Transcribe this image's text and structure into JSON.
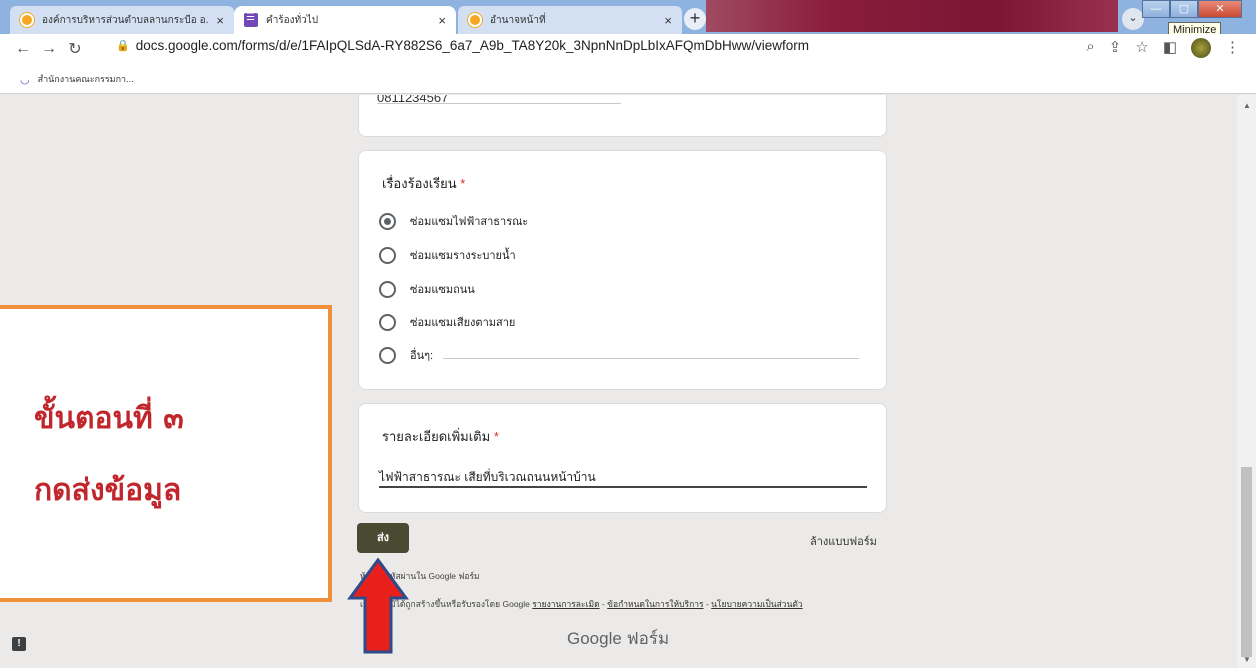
{
  "browser": {
    "tabs": [
      {
        "label": "องค์การบริหารส่วนตำบลลานกระบือ อ.",
        "favicon": "orange-circle-icon"
      },
      {
        "label": "คำร้องทั่วไป",
        "favicon": "google-forms-icon"
      },
      {
        "label": "อำนาจหน้าที่",
        "favicon": "orange-circle-icon"
      }
    ],
    "tab_close": "×",
    "new_tab": "+",
    "tooltip": "Minimize",
    "url": "docs.google.com/forms/d/e/1FAIpQLSdA-RY882S6_6a7_A9b_TA8Y20k_3NpnNnDpLbIxAFQmDbHww/viewform",
    "bookmark": "สำนักงานคณะกรรมกา..."
  },
  "form": {
    "phone_value": "0811234567",
    "complaint": {
      "title": "เรื่องร้องเรียน",
      "required_mark": "*",
      "options": [
        {
          "label": "ซ่อมแซมไฟฟ้าสาธารณะ",
          "selected": true
        },
        {
          "label": "ซ่อมแซมรางระบายน้ำ",
          "selected": false
        },
        {
          "label": "ซ่อมแซมถนน",
          "selected": false
        },
        {
          "label": "ซ่อมแซมเสียงตามสาย",
          "selected": false
        },
        {
          "label": "อื่นๆ:",
          "selected": false
        }
      ]
    },
    "details": {
      "title": "รายละเอียดเพิ่มเติม",
      "required_mark": "*",
      "value": "ไฟฟ้าสาธารณะ เสียที่บริเวณถนนหน้าบ้าน"
    },
    "submit_label": "ส่ง",
    "clear_label": "ล้างแบบฟอร์ม",
    "never_submit": "ห้ามส่งรหัสผ่านใน Google ฟอร์ม",
    "disclaimer_prefix": "เนื้อหานี้มิได้ถูกสร้างขึ้นหรือรับรองโดย Google",
    "disclaimer_links": [
      "รายงานการละเมิด",
      "ข้อกำหนดในการให้บริการ",
      "นโยบายความเป็นส่วนตัว"
    ],
    "brand_google": "Google",
    "brand_forms": "ฟอร์ม"
  },
  "annotation": {
    "line1": "ขั้นตอนที่ ๓",
    "line2": "กดส่งข้อมูล",
    "border_color": "#f0903a",
    "text_color": "#c0262b",
    "arrow_color": "#e8201c"
  }
}
